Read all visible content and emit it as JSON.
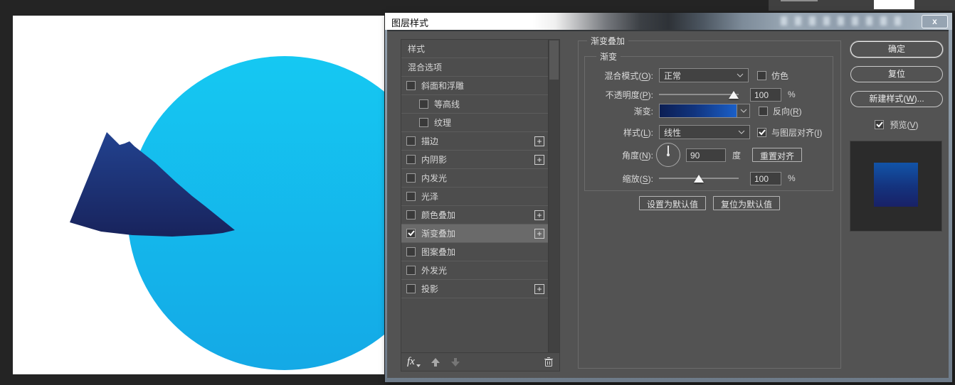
{
  "app": {
    "top_bar_note": "",
    "colors": {
      "workspace_bg": "#242424",
      "panel_strip": "#404040"
    }
  },
  "canvas": {
    "circle": {
      "color_top": "#15c8f2",
      "color_bottom": "#14a9e6"
    },
    "mountain": {
      "color_top": "#22428f",
      "color_bottom": "#18235c"
    },
    "background": "#ffffff"
  },
  "dialog": {
    "title": "图层样式",
    "close": "x",
    "styles_list": {
      "items": [
        {
          "label": "样式",
          "checkbox": false,
          "checked": false,
          "plus": false,
          "indent": false,
          "selected": false
        },
        {
          "label": "混合选项",
          "checkbox": false,
          "checked": false,
          "plus": false,
          "indent": false,
          "selected": false
        },
        {
          "label": "斜面和浮雕",
          "checkbox": true,
          "checked": false,
          "plus": false,
          "indent": false,
          "selected": false
        },
        {
          "label": "等高线",
          "checkbox": true,
          "checked": false,
          "plus": false,
          "indent": true,
          "selected": false
        },
        {
          "label": "纹理",
          "checkbox": true,
          "checked": false,
          "plus": false,
          "indent": true,
          "selected": false
        },
        {
          "label": "描边",
          "checkbox": true,
          "checked": false,
          "plus": true,
          "indent": false,
          "selected": false
        },
        {
          "label": "内阴影",
          "checkbox": true,
          "checked": false,
          "plus": true,
          "indent": false,
          "selected": false
        },
        {
          "label": "内发光",
          "checkbox": true,
          "checked": false,
          "plus": false,
          "indent": false,
          "selected": false
        },
        {
          "label": "光泽",
          "checkbox": true,
          "checked": false,
          "plus": false,
          "indent": false,
          "selected": false
        },
        {
          "label": "颜色叠加",
          "checkbox": true,
          "checked": false,
          "plus": true,
          "indent": false,
          "selected": false
        },
        {
          "label": "渐变叠加",
          "checkbox": true,
          "checked": true,
          "plus": true,
          "indent": false,
          "selected": true
        },
        {
          "label": "图案叠加",
          "checkbox": true,
          "checked": false,
          "plus": false,
          "indent": false,
          "selected": false
        },
        {
          "label": "外发光",
          "checkbox": true,
          "checked": false,
          "plus": false,
          "indent": false,
          "selected": false
        },
        {
          "label": "投影",
          "checkbox": true,
          "checked": false,
          "plus": true,
          "indent": false,
          "selected": false
        }
      ],
      "plus_glyph": "+"
    },
    "footer": {
      "fx": "fx"
    },
    "panel": {
      "section_title": "渐变叠加",
      "group_title": "渐变",
      "rows": {
        "blend_mode": {
          "pre": "混合模式(",
          "key": "O",
          "post": "):",
          "value": "正常"
        },
        "dither": {
          "pre": "仿色",
          "key": "",
          "post": "",
          "checked": false
        },
        "opacity": {
          "pre": "不透明度(",
          "key": "P",
          "post": "):",
          "value": "100",
          "unit": "%"
        },
        "gradient": {
          "label": "渐变:",
          "swatch_left": "#0b1e53",
          "swatch_right": "#1a5fc8"
        },
        "reverse": {
          "pre": "反向(",
          "key": "R",
          "post": ")",
          "checked": false
        },
        "style": {
          "pre": "样式(",
          "key": "L",
          "post": "):",
          "value": "线性"
        },
        "align_layer": {
          "pre": "与图层对齐(",
          "key": "I",
          "post": ")",
          "checked": true
        },
        "angle": {
          "pre": "角度(",
          "key": "N",
          "post": "):",
          "value": "90",
          "unit": "度",
          "reset": "重置对齐"
        },
        "scale": {
          "pre": "缩放(",
          "key": "S",
          "post": "):",
          "value": "100",
          "unit": "%"
        }
      },
      "defaults": {
        "set": "设置为默认值",
        "reset": "复位为默认值"
      }
    },
    "actions": {
      "ok": "确定",
      "reset": "复位",
      "new_style_pre": "新建样式(",
      "new_style_key": "W",
      "new_style_post": ")...",
      "preview_pre": "预览(",
      "preview_key": "V",
      "preview_post": ")",
      "preview_checked": true,
      "thumb_gradient_top": "#1254a8",
      "thumb_gradient_bottom": "#192166"
    }
  },
  "icons": {
    "chevron_down": "v",
    "check": "check-mark",
    "trash": "trash-can",
    "arrow_up": "up-arrow",
    "arrow_down": "down-arrow",
    "fx_menu": "fx"
  }
}
